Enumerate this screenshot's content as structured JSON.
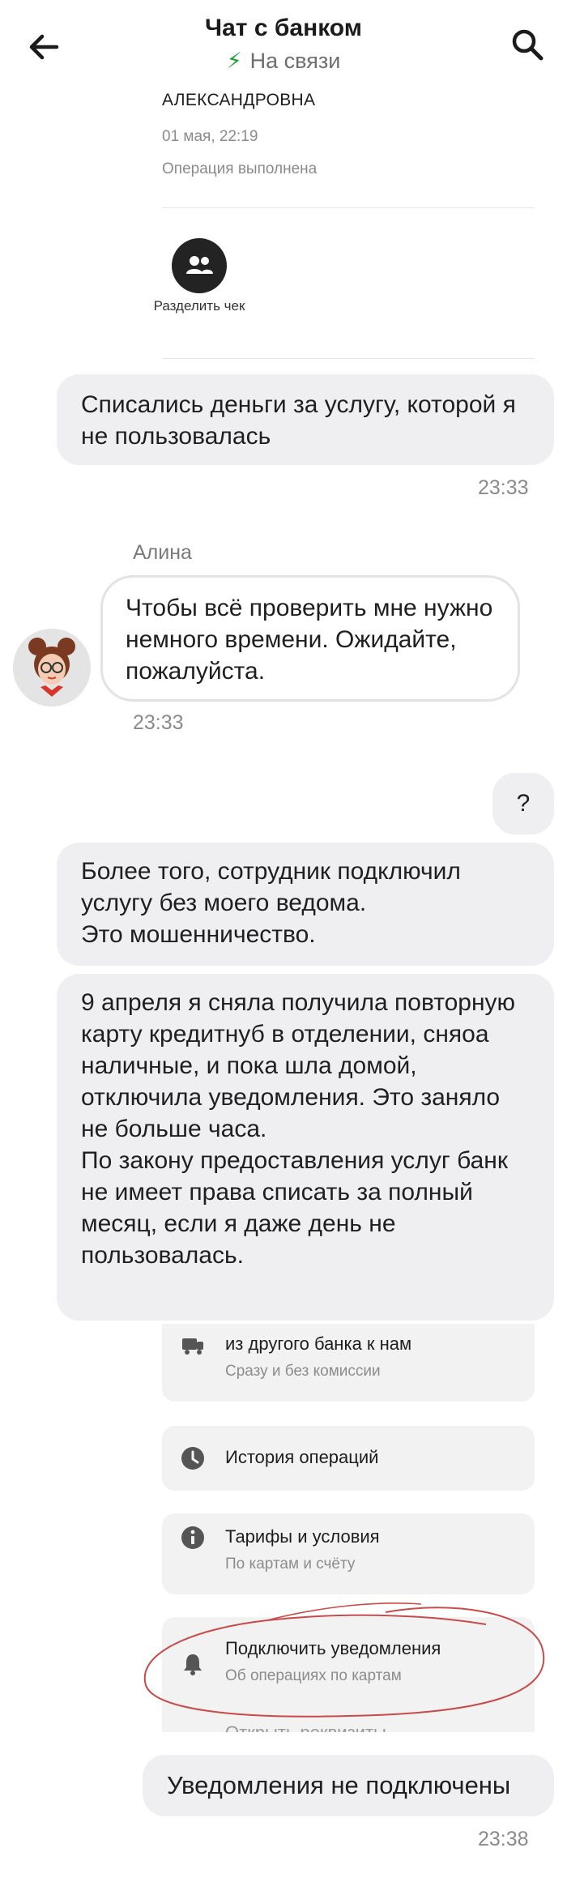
{
  "header": {
    "title": "Чат с банком",
    "status": "На связи"
  },
  "operation_card": {
    "name_tail": "АЛЕКСАНДРОВНА",
    "datetime": "01 мая, 22:19",
    "status": "Операция выполнена",
    "split_label": "Разделить чек"
  },
  "messages": {
    "m1": {
      "text": "Списались деньги за услугу, которой я не пользовалась",
      "time": "23:33"
    },
    "agent": {
      "name": "Алина",
      "text": "Чтобы всё проверить мне нужно немного времени. Ожидайте, пожалуйста.",
      "time": "23:33"
    },
    "m2": {
      "text": "?"
    },
    "m3": {
      "text": "Более того, сотрудник подключил услугу без моего ведома.\nЭто мошенничество."
    },
    "m4": {
      "text": "9 апреля я сняла получила повторную карту кредитнуб в отделении, сняоа наличные, и пока шла домой, отключила уведомления. Это заняло не больше часа.\nПо закону предоставления услуг банк не имеет права списать за полный месяц, если я даже день не пользовалась."
    },
    "m5": {
      "text": "Уведомления не подключены",
      "time": "23:38"
    }
  },
  "menu": {
    "transfer": {
      "title": "из другого банка к нам",
      "sub": "Сразу и без комиссии",
      "icon": "transfer-truck-icon"
    },
    "history": {
      "title": "История операций",
      "icon": "clock-icon"
    },
    "tariffs": {
      "title": "Тарифы и условия",
      "sub": "По картам и счёту",
      "icon": "info-icon"
    },
    "notify": {
      "title": "Подключить уведомления",
      "sub": "Об операциях по картам",
      "icon": "bell-icon"
    },
    "cut_off": {
      "title": "Открыть реквизиты"
    }
  },
  "colors": {
    "accent_green": "#21a038",
    "bubble_bg": "#efeff1",
    "annotation_red": "#c94a4a"
  }
}
